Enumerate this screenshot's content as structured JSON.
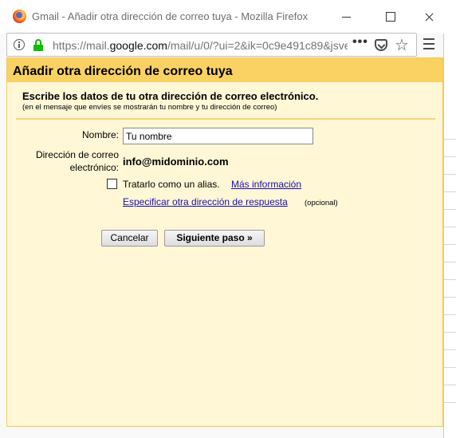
{
  "window": {
    "title": "Gmail - Añadir otra dirección de correo tuya - Mozilla Firefox"
  },
  "urlbar": {
    "url_prefix": "https://mail.",
    "url_domain": "google.com",
    "url_rest": "/mail/u/0/?ui=2&ik=0c9e491c89&jsver",
    "more_label": "•••"
  },
  "icons": {
    "browser": "firefox-logo",
    "minimize": "minimize-icon",
    "maximize": "maximize-icon",
    "close": "close-icon",
    "info": "info-icon",
    "lock": "lock-icon",
    "pocket": "pocket-icon",
    "bookmark": "star-icon",
    "menu": "hamburger-icon"
  },
  "dialog": {
    "title": "Añadir otra dirección de correo tuya",
    "intro_title": "Escribe los datos de tu otra dirección de correo electrónico.",
    "intro_subtitle": "(en el mensaje que envíes se mostrarán tu nombre y tu dirección de correo)",
    "name_label": "Nombre:",
    "name_value": "Tu nombre",
    "email_label_line1": "Dirección de correo",
    "email_label_line2": "electrónico:",
    "email_value": "info@midominio.com",
    "alias_checked": false,
    "alias_label": "Tratarlo como un alias.",
    "more_info_link": "Más información",
    "reply_link": "Especificar otra dirección de respuesta",
    "optional_label": "(opcional)",
    "cancel_label": "Cancelar",
    "next_label": "Siguiente paso »"
  },
  "colors": {
    "header_bg": "#fad163",
    "dialog_bg": "#fff7d6",
    "link": "#1a0dab",
    "lock_green": "#12bc00"
  }
}
